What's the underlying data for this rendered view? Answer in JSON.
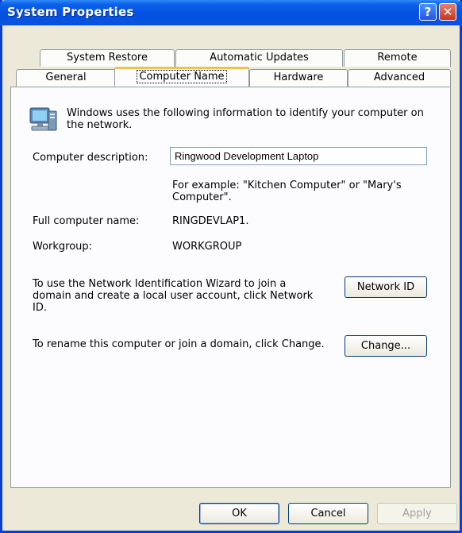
{
  "window": {
    "title": "System Properties",
    "help_glyph": "?",
    "close_glyph": "✕"
  },
  "tabs": {
    "back": [
      "System Restore",
      "Automatic Updates",
      "Remote"
    ],
    "front": [
      "General",
      "Computer Name",
      "Hardware",
      "Advanced"
    ],
    "active": "Computer Name"
  },
  "content": {
    "intro": "Windows uses the following information to identify your computer on the network.",
    "description_label": "Computer description:",
    "description_value": "Ringwood Development Laptop",
    "example_text": "For example: \"Kitchen Computer\" or \"Mary's Computer\".",
    "full_name_label": "Full computer name:",
    "full_name_value": "RINGDEVLAP1.",
    "workgroup_label": "Workgroup:",
    "workgroup_value": "WORKGROUP",
    "wizard_text": "To use the Network Identification Wizard to join a domain and create a local user account, click Network ID.",
    "network_id_button": "Network ID",
    "rename_text": "To rename this computer or join a domain, click Change.",
    "change_button": "Change..."
  },
  "footer": {
    "ok": "OK",
    "cancel": "Cancel",
    "apply": "Apply"
  },
  "colors": {
    "title_bar": "#0451e0",
    "active_tab_highlight": "#f5c244",
    "dialog_bg": "#ece9d8"
  }
}
